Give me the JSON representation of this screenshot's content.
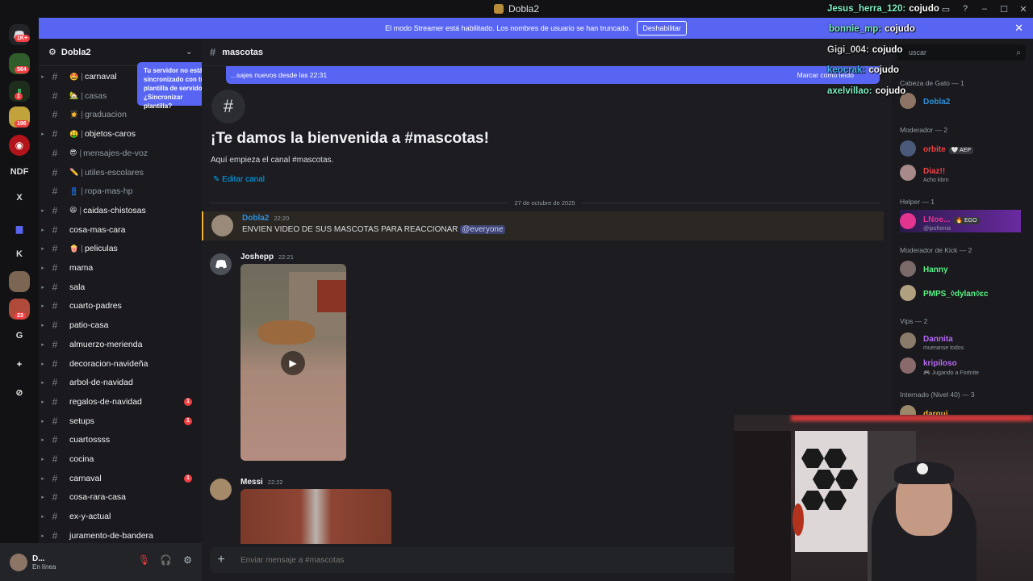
{
  "window": {
    "title": "Dobla2",
    "minimize": "–",
    "maximize": "☐",
    "close": "✕"
  },
  "streamer_banner": {
    "text": "El modo Streamer está habilitado. Los nombres de usuario se han truncado.",
    "button": "Deshabilitar",
    "close": "✕"
  },
  "guilds": [
    {
      "label": "",
      "badge": "1K+"
    },
    {
      "label": "",
      "badge": "564"
    },
    {
      "label": "",
      "badge": "1"
    },
    {
      "label": "",
      "badge": "196"
    },
    {
      "label": "",
      "badge": ""
    },
    {
      "label": "NDF",
      "badge": ""
    },
    {
      "label": "X",
      "badge": ""
    },
    {
      "label": "",
      "badge": ""
    },
    {
      "label": "K",
      "badge": ""
    },
    {
      "label": "",
      "badge": ""
    },
    {
      "label": "",
      "badge": "23"
    },
    {
      "label": "G",
      "badge": ""
    },
    {
      "label": "+",
      "badge": ""
    },
    {
      "label": "⊘",
      "badge": ""
    }
  ],
  "server": {
    "name": "Dobla2"
  },
  "channels": [
    {
      "name": "carnaval",
      "emoji": "🤩",
      "sep": true,
      "unread": true,
      "muted": false,
      "badge": ""
    },
    {
      "name": "casas",
      "emoji": "🏡",
      "sep": true,
      "unread": false,
      "muted": true,
      "badge": ""
    },
    {
      "name": "graduacion",
      "emoji": "👩‍🎓",
      "sep": true,
      "unread": false,
      "muted": true,
      "badge": ""
    },
    {
      "name": "objetos-caros",
      "emoji": "🤑",
      "sep": true,
      "unread": true,
      "muted": false,
      "badge": ""
    },
    {
      "name": "mensajes-de-voz",
      "emoji": "😎",
      "sep": true,
      "unread": false,
      "muted": true,
      "badge": ""
    },
    {
      "name": "utiles-escolares",
      "emoji": "✏️",
      "sep": true,
      "unread": false,
      "muted": true,
      "badge": ""
    },
    {
      "name": "ropa-mas-hp",
      "emoji": "👖",
      "sep": true,
      "unread": false,
      "muted": true,
      "badge": ""
    },
    {
      "name": "caidas-chistosas",
      "emoji": "😆",
      "sep": true,
      "unread": true,
      "muted": false,
      "badge": ""
    },
    {
      "name": "cosa-mas-cara",
      "emoji": "",
      "sep": false,
      "unread": true,
      "muted": false,
      "badge": ""
    },
    {
      "name": "peliculas",
      "emoji": "🍿",
      "sep": true,
      "unread": true,
      "muted": false,
      "badge": ""
    },
    {
      "name": "mama",
      "emoji": "",
      "sep": false,
      "unread": true,
      "muted": false,
      "badge": ""
    },
    {
      "name": "sala",
      "emoji": "",
      "sep": false,
      "unread": true,
      "muted": false,
      "badge": ""
    },
    {
      "name": "cuarto-padres",
      "emoji": "",
      "sep": false,
      "unread": true,
      "muted": false,
      "badge": ""
    },
    {
      "name": "patio-casa",
      "emoji": "",
      "sep": false,
      "unread": true,
      "muted": false,
      "badge": ""
    },
    {
      "name": "almuerzo-merienda",
      "emoji": "",
      "sep": false,
      "unread": true,
      "muted": false,
      "badge": ""
    },
    {
      "name": "decoracion-navideña",
      "emoji": "",
      "sep": false,
      "unread": true,
      "muted": false,
      "badge": ""
    },
    {
      "name": "arbol-de-navidad",
      "emoji": "",
      "sep": false,
      "unread": true,
      "muted": false,
      "badge": ""
    },
    {
      "name": "regalos-de-navidad",
      "emoji": "",
      "sep": false,
      "unread": true,
      "muted": false,
      "badge": "1"
    },
    {
      "name": "setups",
      "emoji": "",
      "sep": false,
      "unread": true,
      "muted": false,
      "badge": "1"
    },
    {
      "name": "cuartossss",
      "emoji": "",
      "sep": false,
      "unread": true,
      "muted": false,
      "badge": ""
    },
    {
      "name": "cocina",
      "emoji": "",
      "sep": false,
      "unread": true,
      "muted": false,
      "badge": ""
    },
    {
      "name": "carnaval",
      "emoji": "",
      "sep": false,
      "unread": true,
      "muted": false,
      "badge": "1"
    },
    {
      "name": "cosa-rara-casa",
      "emoji": "",
      "sep": false,
      "unread": true,
      "muted": false,
      "badge": ""
    },
    {
      "name": "ex-y-actual",
      "emoji": "",
      "sep": false,
      "unread": true,
      "muted": false,
      "badge": ""
    },
    {
      "name": "juramento-de-bandera",
      "emoji": "",
      "sep": false,
      "unread": true,
      "muted": false,
      "badge": ""
    }
  ],
  "sync_tooltip": "Tu servidor no está sincronizado con tu plantilla de servidor. ¿Sincronizar plantilla?",
  "user_panel": {
    "name": "D...",
    "status": "En línea"
  },
  "channel_header": {
    "name": "mascotas"
  },
  "new_messages": {
    "text": "...sajes nuevos desde las 22:31",
    "mark_read": "Marcar como leído"
  },
  "welcome": {
    "title": "¡Te damos la bienvenida a #mascotas!",
    "subtitle": "Aquí empieza el canal #mascotas.",
    "edit": "Editar canal"
  },
  "date_separator": "27 de octubre de 2025",
  "messages": [
    {
      "author": "Dobla2",
      "time": "22:20",
      "text": "ENVIEN VIDEO DE SUS MASCOTAS PARA REACCIONAR",
      "mention": "@everyone",
      "color": "#2e8fd8"
    },
    {
      "author": "Joshepp",
      "time": "22:21",
      "text": "",
      "mention": "",
      "color": "#f2f3f5"
    },
    {
      "author": "Messi",
      "time": "22:22",
      "text": "",
      "mention": "",
      "color": "#f2f3f5"
    }
  ],
  "composer": {
    "placeholder": "Enviar mensaje a #mascotas"
  },
  "member_search": {
    "placeholder": "uscar"
  },
  "members": {
    "roles": [
      "Cabeza de Gato — 1",
      "Moderador — 2",
      "Helper — 1",
      "Moderador de Kick — 2",
      "Vips — 2",
      "Internado (Nivel 40) — 3"
    ],
    "list": [
      {
        "name": "Dobla2",
        "status": "",
        "tag": "",
        "color": "#2e8fd8"
      },
      {
        "name": "orbite",
        "status": "",
        "tag": "🤍 AEP",
        "color": "#ed4245"
      },
      {
        "name": "Diaz!!",
        "status": "Acho kbrn",
        "tag": "",
        "color": "#ed4245"
      },
      {
        "name": "LNoe...",
        "status": "@ipofrenia",
        "tag": "🔥 EGO",
        "color": "#e3348f"
      },
      {
        "name": "Hanny",
        "status": "",
        "tag": "",
        "color": "#57f287"
      },
      {
        "name": "PMPS_◊dylan◊ɛc",
        "status": "",
        "tag": "",
        "color": "#57f287"
      },
      {
        "name": "Dannita",
        "status": "mueranse todos",
        "tag": "",
        "color": "#b46af0"
      },
      {
        "name": "kripiloso",
        "status": "🎮 Jugando a Fortnite",
        "tag": "",
        "color": "#b46af0"
      },
      {
        "name": "dargui",
        "status": "",
        "tag": "",
        "color": "#f0b232"
      }
    ]
  },
  "chat_overlay": [
    {
      "user": "Jesus_herra_120:",
      "msg": "cojudo",
      "color": "#7ef0c5"
    },
    {
      "user": "bonnie_mp:",
      "msg": "cojudo",
      "color": "#7ef0c5"
    },
    {
      "user": "Gigi_004:",
      "msg": "cojudo",
      "color": "#d8d8d8"
    },
    {
      "user": "keocrak:",
      "msg": "cojudo",
      "color": "#4ab3e8"
    },
    {
      "user": "axelvillao:",
      "msg": "cojudo",
      "color": "#7ef0c5"
    }
  ],
  "icons": {
    "server_gear": "gear-icon",
    "hash": "hash-icon",
    "mute": "mic-muted-icon",
    "deafen": "headphones-muted-icon",
    "settings": "settings-icon"
  }
}
